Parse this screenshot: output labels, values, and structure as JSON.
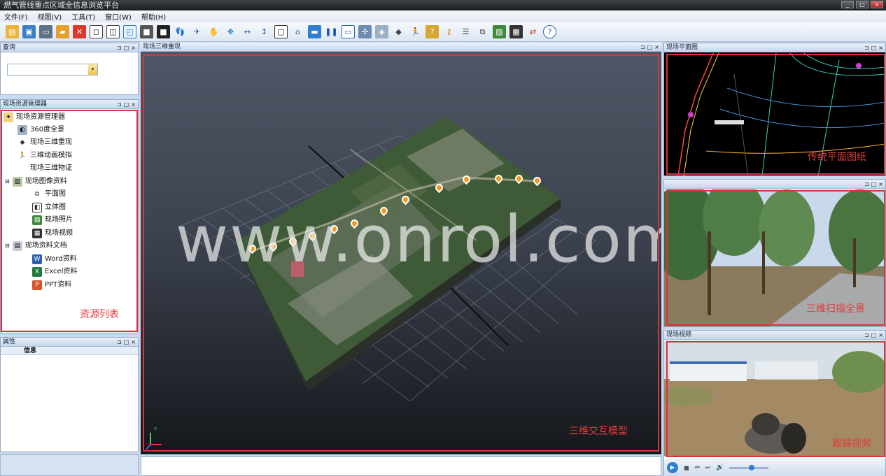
{
  "window": {
    "title": "燃气管线重点区域全信息浏览平台"
  },
  "menu": [
    "文件(F)",
    "视图(V)",
    "工具(T)",
    "窗口(W)",
    "帮助(H)"
  ],
  "toolbar_icons": [
    "open-icon",
    "save-icon",
    "print-icon",
    "folder-icon",
    "delete-icon",
    "cube-front-icon",
    "cube-side-icon",
    "cube-top-icon",
    "cube-solid-icon",
    "cube-dark-icon",
    "walk-icon",
    "fly-icon",
    "hand-icon",
    "move-icon",
    "horizontal-arrow-icon",
    "vertical-arrow-icon",
    "frame-icon",
    "home-icon",
    "monitor-icon",
    "pause-icon",
    "window-icon",
    "grid-icon",
    "satellite-icon",
    "eraser-icon",
    "person-icon",
    "help-book-icon",
    "key-icon",
    "list-icon",
    "layers-icon",
    "picture-icon",
    "film-icon",
    "link-icon",
    "question-icon"
  ],
  "query_panel": {
    "title": "查询"
  },
  "resource_panel": {
    "title": "现场资源管理器",
    "items": [
      {
        "label": "现场资源管理器",
        "icon": "folder-tree-icon"
      },
      {
        "label": "360度全景",
        "icon": "panorama-icon"
      },
      {
        "label": "现场三维重现",
        "icon": "cube-icon"
      },
      {
        "label": "三维动画模拟",
        "icon": "person-icon"
      },
      {
        "label": "现场三维物证",
        "icon": ""
      },
      {
        "label": "现场图像资料",
        "icon": "image-folder-icon"
      },
      {
        "label": "平面图",
        "icon": "plan-icon"
      },
      {
        "label": "立体图",
        "icon": "stereo-icon"
      },
      {
        "label": "现场照片",
        "icon": "photo-icon"
      },
      {
        "label": "现场视频",
        "icon": "video-icon"
      },
      {
        "label": "现场资料文档",
        "icon": "docs-icon"
      },
      {
        "label": "Word资料",
        "icon": "word-icon"
      },
      {
        "label": "Excel资料",
        "icon": "excel-icon"
      },
      {
        "label": "PPT资料",
        "icon": "ppt-icon"
      }
    ],
    "annotation": "资源列表"
  },
  "props_panel": {
    "title": "属性",
    "header": "信息"
  },
  "scene_panel": {
    "title": "现场三维重现",
    "annotation": "三维交互模型",
    "watermark": "www.onrol.com",
    "axis_label": "Y"
  },
  "plan_panel": {
    "title": "现场平面图",
    "annotation": "传统平面图纸"
  },
  "panorama_panel": {
    "annotation": "三维扫描全景"
  },
  "video_panel": {
    "title": "现场视频",
    "annotation": "跟踪视频"
  },
  "colors": {
    "accent_red": "#d8343a",
    "pin_orange": "#f39a1e"
  }
}
